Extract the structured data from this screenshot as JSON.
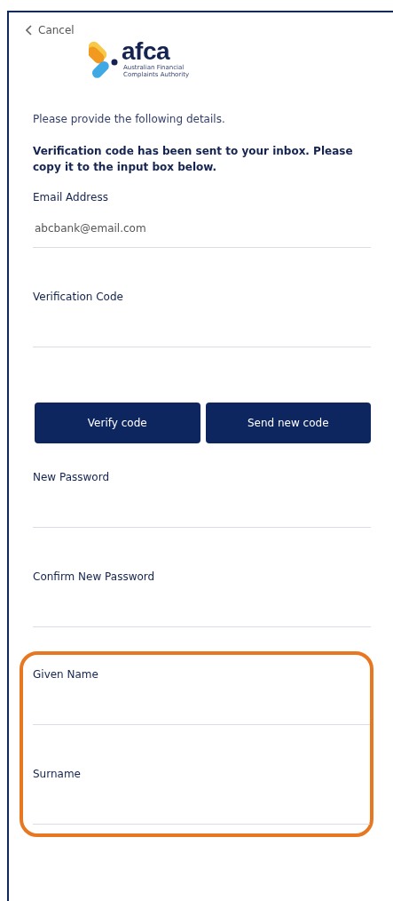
{
  "back_link": {
    "label": "Cancel"
  },
  "logo": {
    "wordmark": "afca",
    "tagline_lines": [
      "Australian Financial",
      "Complaints Authority"
    ]
  },
  "intro": "Please provide the following details.",
  "notice": "Verification code has been sent to your inbox. Please copy it to the input box below.",
  "verification_fields": [
    {
      "label": "Email Address",
      "value": "abcbank@email.com"
    },
    {
      "label": "Verification Code"
    }
  ],
  "buttons": [
    {
      "label": "Verify code"
    },
    {
      "label": "Send new code"
    }
  ],
  "password_fields": [
    {
      "label": "New Password"
    },
    {
      "label": "Confirm New Password"
    }
  ],
  "highlighted_group": {
    "fields": [
      {
        "label": "Given Name"
      },
      {
        "label": "Surname"
      }
    ]
  }
}
